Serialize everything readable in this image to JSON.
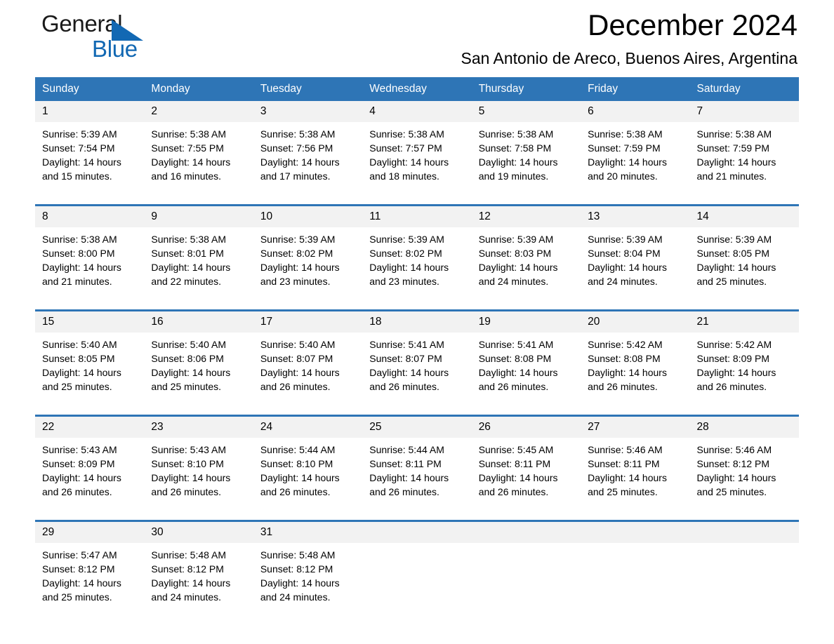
{
  "brand": {
    "word_general": "General",
    "word_blue": "Blue",
    "accent_color": "#1268b3"
  },
  "header": {
    "title": "December 2024",
    "subtitle": "San Antonio de Areco, Buenos Aires, Argentina"
  },
  "calendar": {
    "header_bg": "#2e75b6",
    "daynum_bg": "#f2f2f2",
    "day_names": [
      "Sunday",
      "Monday",
      "Tuesday",
      "Wednesday",
      "Thursday",
      "Friday",
      "Saturday"
    ],
    "weeks": [
      [
        {
          "day": "1",
          "sunrise": "Sunrise: 5:39 AM",
          "sunset": "Sunset: 7:54 PM",
          "daylight": "Daylight: 14 hours and 15 minutes."
        },
        {
          "day": "2",
          "sunrise": "Sunrise: 5:38 AM",
          "sunset": "Sunset: 7:55 PM",
          "daylight": "Daylight: 14 hours and 16 minutes."
        },
        {
          "day": "3",
          "sunrise": "Sunrise: 5:38 AM",
          "sunset": "Sunset: 7:56 PM",
          "daylight": "Daylight: 14 hours and 17 minutes."
        },
        {
          "day": "4",
          "sunrise": "Sunrise: 5:38 AM",
          "sunset": "Sunset: 7:57 PM",
          "daylight": "Daylight: 14 hours and 18 minutes."
        },
        {
          "day": "5",
          "sunrise": "Sunrise: 5:38 AM",
          "sunset": "Sunset: 7:58 PM",
          "daylight": "Daylight: 14 hours and 19 minutes."
        },
        {
          "day": "6",
          "sunrise": "Sunrise: 5:38 AM",
          "sunset": "Sunset: 7:59 PM",
          "daylight": "Daylight: 14 hours and 20 minutes."
        },
        {
          "day": "7",
          "sunrise": "Sunrise: 5:38 AM",
          "sunset": "Sunset: 7:59 PM",
          "daylight": "Daylight: 14 hours and 21 minutes."
        }
      ],
      [
        {
          "day": "8",
          "sunrise": "Sunrise: 5:38 AM",
          "sunset": "Sunset: 8:00 PM",
          "daylight": "Daylight: 14 hours and 21 minutes."
        },
        {
          "day": "9",
          "sunrise": "Sunrise: 5:38 AM",
          "sunset": "Sunset: 8:01 PM",
          "daylight": "Daylight: 14 hours and 22 minutes."
        },
        {
          "day": "10",
          "sunrise": "Sunrise: 5:39 AM",
          "sunset": "Sunset: 8:02 PM",
          "daylight": "Daylight: 14 hours and 23 minutes."
        },
        {
          "day": "11",
          "sunrise": "Sunrise: 5:39 AM",
          "sunset": "Sunset: 8:02 PM",
          "daylight": "Daylight: 14 hours and 23 minutes."
        },
        {
          "day": "12",
          "sunrise": "Sunrise: 5:39 AM",
          "sunset": "Sunset: 8:03 PM",
          "daylight": "Daylight: 14 hours and 24 minutes."
        },
        {
          "day": "13",
          "sunrise": "Sunrise: 5:39 AM",
          "sunset": "Sunset: 8:04 PM",
          "daylight": "Daylight: 14 hours and 24 minutes."
        },
        {
          "day": "14",
          "sunrise": "Sunrise: 5:39 AM",
          "sunset": "Sunset: 8:05 PM",
          "daylight": "Daylight: 14 hours and 25 minutes."
        }
      ],
      [
        {
          "day": "15",
          "sunrise": "Sunrise: 5:40 AM",
          "sunset": "Sunset: 8:05 PM",
          "daylight": "Daylight: 14 hours and 25 minutes."
        },
        {
          "day": "16",
          "sunrise": "Sunrise: 5:40 AM",
          "sunset": "Sunset: 8:06 PM",
          "daylight": "Daylight: 14 hours and 25 minutes."
        },
        {
          "day": "17",
          "sunrise": "Sunrise: 5:40 AM",
          "sunset": "Sunset: 8:07 PM",
          "daylight": "Daylight: 14 hours and 26 minutes."
        },
        {
          "day": "18",
          "sunrise": "Sunrise: 5:41 AM",
          "sunset": "Sunset: 8:07 PM",
          "daylight": "Daylight: 14 hours and 26 minutes."
        },
        {
          "day": "19",
          "sunrise": "Sunrise: 5:41 AM",
          "sunset": "Sunset: 8:08 PM",
          "daylight": "Daylight: 14 hours and 26 minutes."
        },
        {
          "day": "20",
          "sunrise": "Sunrise: 5:42 AM",
          "sunset": "Sunset: 8:08 PM",
          "daylight": "Daylight: 14 hours and 26 minutes."
        },
        {
          "day": "21",
          "sunrise": "Sunrise: 5:42 AM",
          "sunset": "Sunset: 8:09 PM",
          "daylight": "Daylight: 14 hours and 26 minutes."
        }
      ],
      [
        {
          "day": "22",
          "sunrise": "Sunrise: 5:43 AM",
          "sunset": "Sunset: 8:09 PM",
          "daylight": "Daylight: 14 hours and 26 minutes."
        },
        {
          "day": "23",
          "sunrise": "Sunrise: 5:43 AM",
          "sunset": "Sunset: 8:10 PM",
          "daylight": "Daylight: 14 hours and 26 minutes."
        },
        {
          "day": "24",
          "sunrise": "Sunrise: 5:44 AM",
          "sunset": "Sunset: 8:10 PM",
          "daylight": "Daylight: 14 hours and 26 minutes."
        },
        {
          "day": "25",
          "sunrise": "Sunrise: 5:44 AM",
          "sunset": "Sunset: 8:11 PM",
          "daylight": "Daylight: 14 hours and 26 minutes."
        },
        {
          "day": "26",
          "sunrise": "Sunrise: 5:45 AM",
          "sunset": "Sunset: 8:11 PM",
          "daylight": "Daylight: 14 hours and 26 minutes."
        },
        {
          "day": "27",
          "sunrise": "Sunrise: 5:46 AM",
          "sunset": "Sunset: 8:11 PM",
          "daylight": "Daylight: 14 hours and 25 minutes."
        },
        {
          "day": "28",
          "sunrise": "Sunrise: 5:46 AM",
          "sunset": "Sunset: 8:12 PM",
          "daylight": "Daylight: 14 hours and 25 minutes."
        }
      ],
      [
        {
          "day": "29",
          "sunrise": "Sunrise: 5:47 AM",
          "sunset": "Sunset: 8:12 PM",
          "daylight": "Daylight: 14 hours and 25 minutes."
        },
        {
          "day": "30",
          "sunrise": "Sunrise: 5:48 AM",
          "sunset": "Sunset: 8:12 PM",
          "daylight": "Daylight: 14 hours and 24 minutes."
        },
        {
          "day": "31",
          "sunrise": "Sunrise: 5:48 AM",
          "sunset": "Sunset: 8:12 PM",
          "daylight": "Daylight: 14 hours and 24 minutes."
        },
        {
          "day": "",
          "sunrise": "",
          "sunset": "",
          "daylight": ""
        },
        {
          "day": "",
          "sunrise": "",
          "sunset": "",
          "daylight": ""
        },
        {
          "day": "",
          "sunrise": "",
          "sunset": "",
          "daylight": ""
        },
        {
          "day": "",
          "sunrise": "",
          "sunset": "",
          "daylight": ""
        }
      ]
    ]
  }
}
